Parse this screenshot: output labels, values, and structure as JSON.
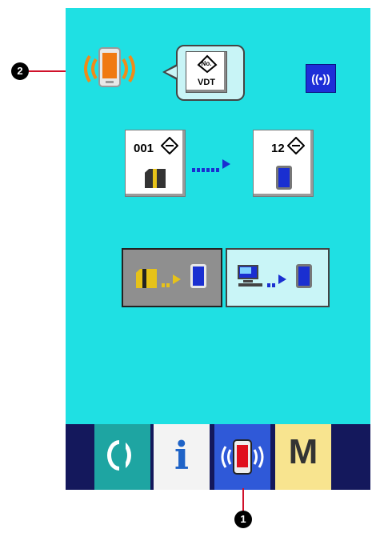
{
  "top": {
    "vdt_label": "VDT",
    "vdt_small": "No.",
    "comm_label": "((•))"
  },
  "transfer": {
    "source_number": "001",
    "dest_number": "12"
  },
  "bottom_tabs": {
    "info_label": "i",
    "mode_label": "M"
  },
  "callouts": {
    "one": "1",
    "two": "2"
  },
  "colors": {
    "screen_bg": "#1fe0e3",
    "bottom_bar": "#14185c",
    "selected_tab": "#2f59d8"
  },
  "icons": [
    "phone-comm-icon",
    "vdt-icon",
    "communication-icon",
    "memory-card-icon",
    "phone-icon",
    "computer-icon",
    "ready-icon",
    "info-icon",
    "mode-icon"
  ]
}
